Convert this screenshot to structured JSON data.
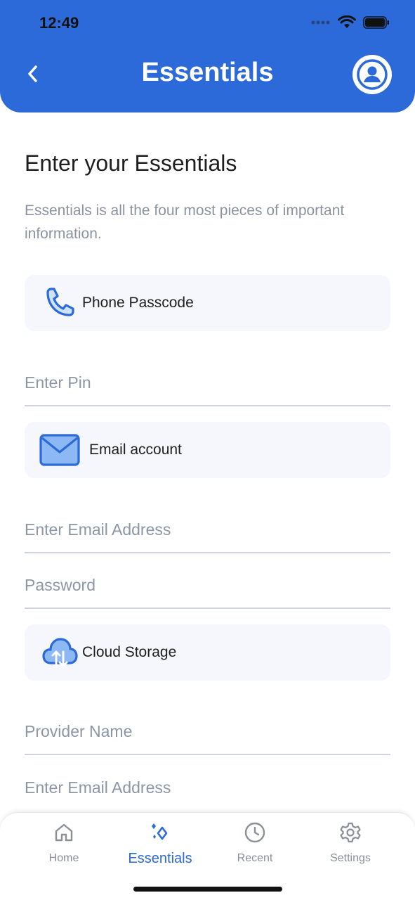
{
  "status_bar": {
    "time": "12:49"
  },
  "header": {
    "title": "Essentials"
  },
  "content": {
    "heading": "Enter your Essentials",
    "description": "Essentials is all the four most pieces of important information."
  },
  "sections": {
    "phone": {
      "label": "Phone Passcode",
      "icon": "phone-icon"
    },
    "email": {
      "label": "Email account",
      "icon": "mail-icon"
    },
    "cloud": {
      "label": "Cloud Storage",
      "icon": "cloud-sync-icon"
    }
  },
  "fields": {
    "pin": {
      "placeholder": "Enter Pin",
      "value": ""
    },
    "email_address": {
      "placeholder": "Enter Email Address",
      "value": ""
    },
    "password": {
      "placeholder": "Password",
      "value": ""
    },
    "provider_name": {
      "placeholder": "Provider Name",
      "value": ""
    },
    "cloud_email": {
      "placeholder": "Enter Email Address",
      "value": ""
    }
  },
  "tabs": [
    {
      "label": "Home",
      "icon": "home-icon",
      "active": false
    },
    {
      "label": "Essentials",
      "icon": "sparkle-icon",
      "active": true
    },
    {
      "label": "Recent",
      "icon": "clock-icon",
      "active": false
    },
    {
      "label": "Settings",
      "icon": "gear-icon",
      "active": false
    }
  ],
  "colors": {
    "primary": "#2b6ad8",
    "card_bg": "#f6f7fc",
    "muted_text": "#8b93a1",
    "icon_fill": "#8cb8f4"
  }
}
